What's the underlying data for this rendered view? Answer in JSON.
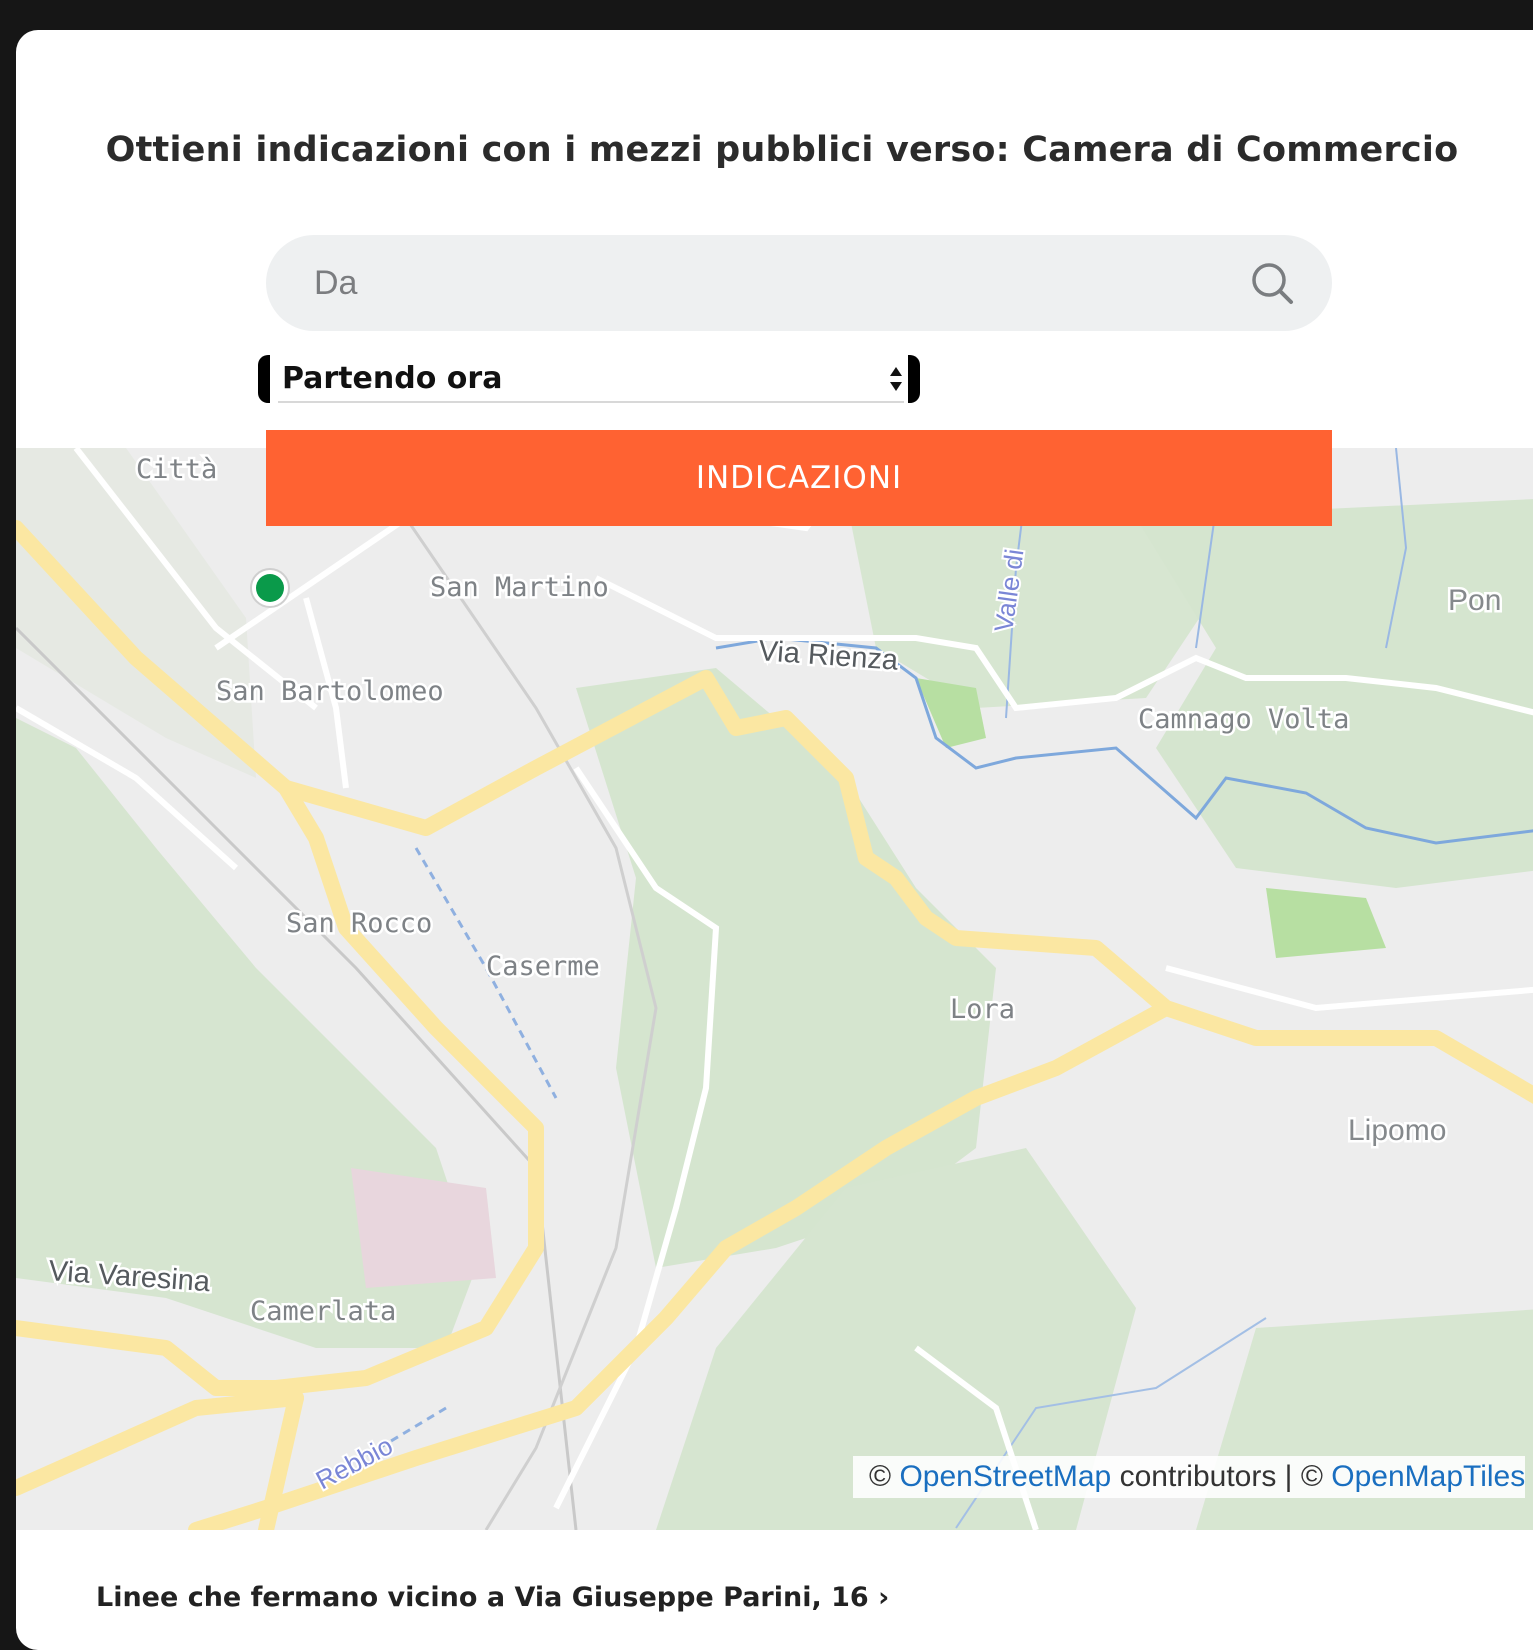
{
  "header": {
    "title": "Ottieni indicazioni con i mezzi pubblici verso: Camera di Commercio"
  },
  "search": {
    "placeholder": "Da",
    "icon": "search-icon"
  },
  "departure": {
    "selected": "Partendo ora"
  },
  "directions_button": {
    "label": "INDICAZIONI",
    "color": "#ff6232"
  },
  "map": {
    "labels": {
      "citta": "Città",
      "san_martino": "San Martino",
      "valle_di": "Valle di",
      "pon": "Pon",
      "via_rienza": "Via Rienza",
      "san_bartolomeo": "San Bartolomeo",
      "camnago_volta": "Camnago Volta",
      "san_rocco": "San Rocco",
      "caserme": "Caserme",
      "lora": "Lora",
      "lipomo": "Lipomo",
      "via_varesina": "Via Varesina",
      "camerlata": "Camerlata",
      "rebbio": "Rebbio"
    },
    "marker_color": "#0a9a4a"
  },
  "attribution": {
    "prefix": "©",
    "osm": "OpenStreetMap",
    "contributors": "contributors |",
    "prefix2": "©",
    "omt": "OpenMapTiles"
  },
  "lines_link": "Linee che fermano vicino a Via Giuseppe Parini, 16 ›"
}
